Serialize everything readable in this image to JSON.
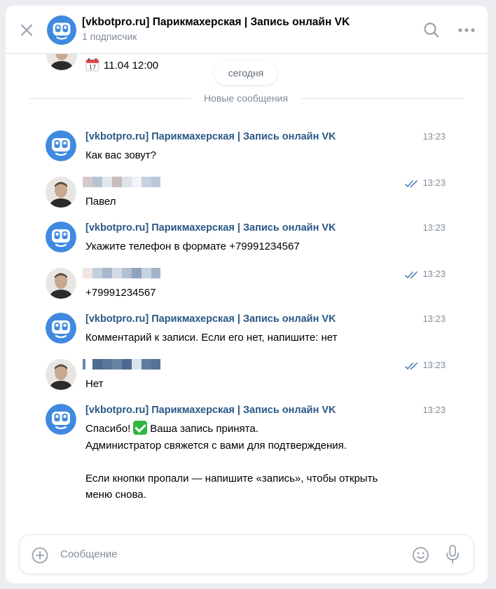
{
  "header": {
    "title": "[vkbotpro.ru] Парикмахерская | Запись онлайн VK",
    "subtitle": "1 подписчик"
  },
  "previous": {
    "text": "11.04 12:00",
    "icon": "calendar-icon"
  },
  "date_separator": "сегодня",
  "new_messages_label": "Новые сообщения",
  "bot_name": "[vkbotpro.ru] Парикмахерская | Запись онлайн VK",
  "messages": [
    {
      "from": "bot",
      "time": "13:23",
      "text": "Как вас зовут?"
    },
    {
      "from": "user",
      "time": "13:23",
      "text": "Павел",
      "read": true
    },
    {
      "from": "bot",
      "time": "13:23",
      "text": "Укажите телефон в формате +79991234567"
    },
    {
      "from": "user",
      "time": "13:23",
      "text": "+79991234567",
      "read": true
    },
    {
      "from": "bot",
      "time": "13:23",
      "text": "Комментарий к записи. Если его нет, напишите: нет"
    },
    {
      "from": "user",
      "time": "13:23",
      "text": "Нет",
      "read": true
    },
    {
      "from": "bot",
      "time": "13:23",
      "text_before": "Спасибо!",
      "text_after": "Ваша запись принята.",
      "line2": "Администратор свяжется с вами для подтверждения.",
      "line3": "Если кнопки пропали — напишите «запись», чтобы открыть",
      "line4": "меню снова."
    }
  ],
  "composer": {
    "placeholder": "Сообщение"
  },
  "colors": {
    "link": "#2a5885",
    "accent": "#3f8ae0",
    "muted": "#818c99",
    "bot_avatar": "#3f8ae0"
  }
}
